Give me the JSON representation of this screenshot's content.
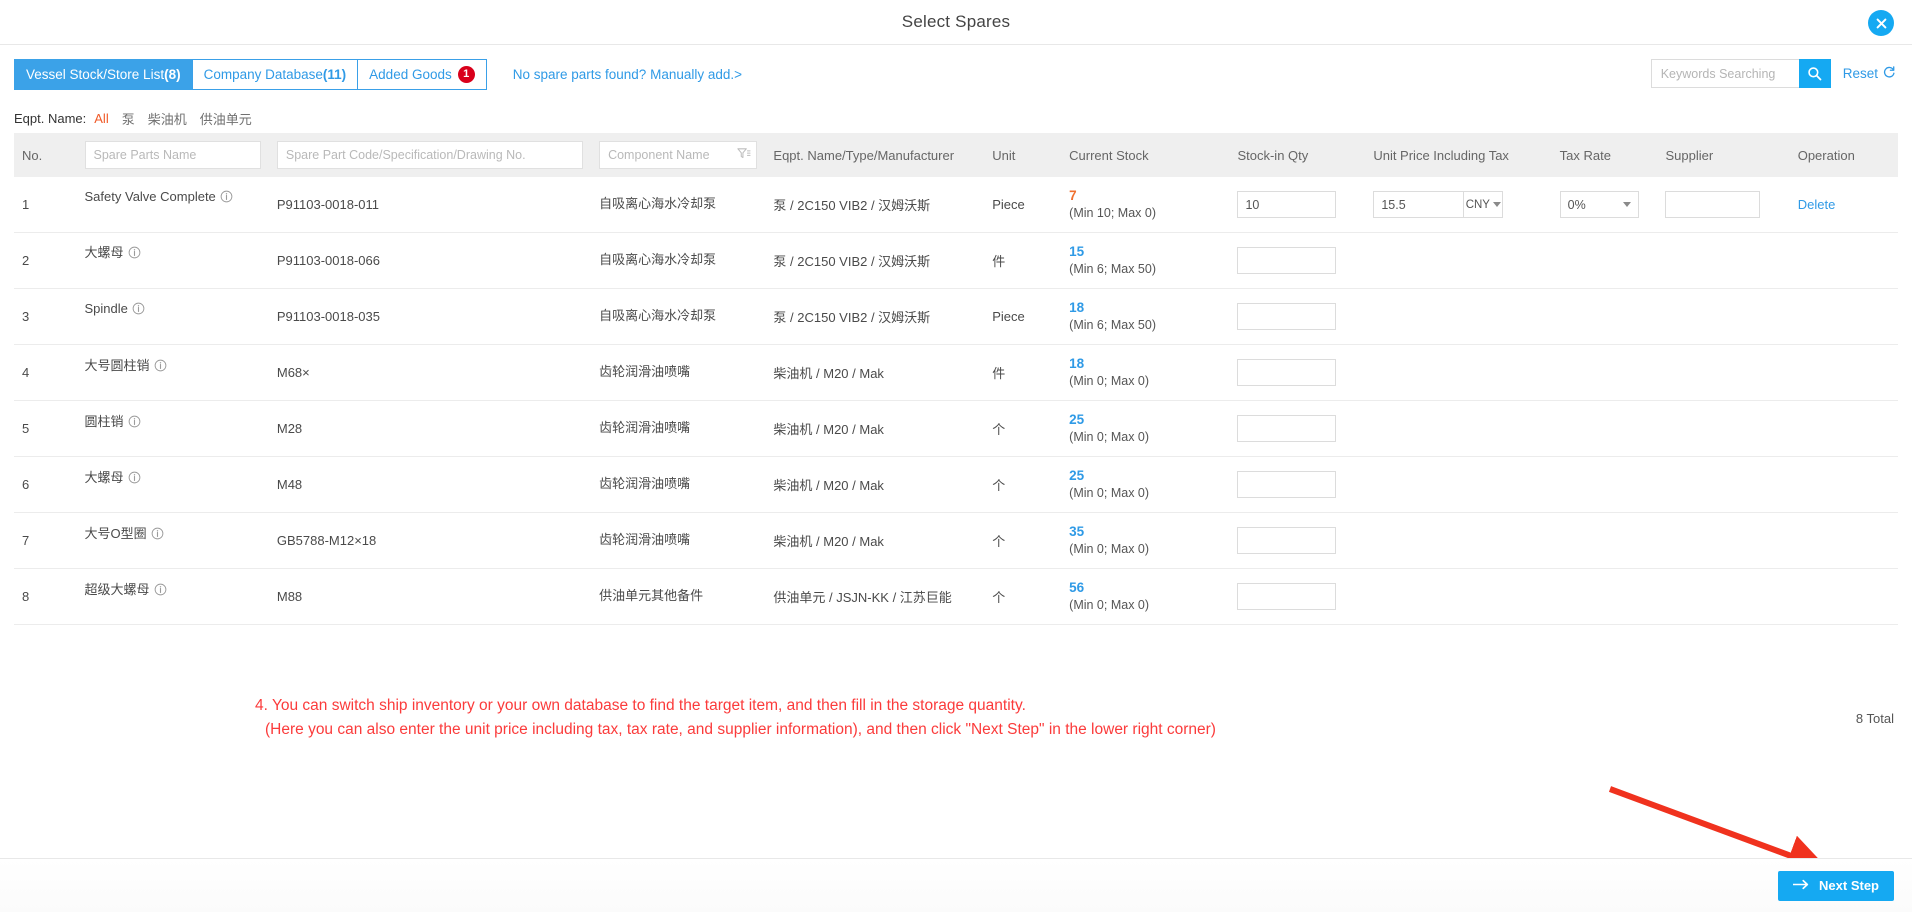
{
  "window": {
    "title": "Select Spares",
    "close_icon": "close-circle-icon"
  },
  "toolbar": {
    "tabs": [
      {
        "label": "Vessel Stock/Store List",
        "count": "(8)",
        "active": true
      },
      {
        "label": "Company Database",
        "count": "(11)",
        "active": false
      },
      {
        "label": "Added Goods",
        "badge": "1",
        "active": false
      }
    ],
    "manual_add_link": "No spare parts found? Manually add.>",
    "search": {
      "placeholder": "Keywords Searching",
      "value": "",
      "icon": "search-icon"
    },
    "reset_label": "Reset",
    "reset_icon": "refresh-icon"
  },
  "filterbar": {
    "label": "Eqpt. Name:",
    "options": [
      {
        "label": "All",
        "active": true
      },
      {
        "label": "泵",
        "active": false
      },
      {
        "label": "柴油机",
        "active": false
      },
      {
        "label": "供油单元",
        "active": false
      }
    ]
  },
  "table": {
    "headers": {
      "no": "No.",
      "spare_parts_name_placeholder": "Spare Parts Name",
      "spare_part_code_placeholder": "Spare Part Code/Specification/Drawing No.",
      "component_name_placeholder": "Component Name",
      "eqpt_name": "Eqpt. Name/Type/Manufacturer",
      "unit": "Unit",
      "current_stock": "Current Stock",
      "stock_in_qty": "Stock-in Qty",
      "unit_price": "Unit Price Including Tax",
      "tax_rate": "Tax Rate",
      "supplier": "Supplier",
      "operation": "Operation"
    },
    "rows": [
      {
        "no": "1",
        "name": "Safety Valve Complete",
        "code": "P91103-0018-011",
        "component": "自吸离心海水冷却泵",
        "eqpt": "泵 / 2C150 VIB2 / 汉姆沃斯",
        "unit": "Piece",
        "stock": "7",
        "stock_state": "low",
        "stock_range": "(Min 10; Max 0)",
        "qty": "10",
        "price": "15.5",
        "currency": "CNY",
        "tax": "0%",
        "supplier": "",
        "operation": "Delete",
        "has_price": true
      },
      {
        "no": "2",
        "name": "大螺母",
        "code": "P91103-0018-066",
        "component": "自吸离心海水冷却泵",
        "eqpt": "泵 / 2C150 VIB2 / 汉姆沃斯",
        "unit": "件",
        "stock": "15",
        "stock_state": "ok",
        "stock_range": "(Min 6; Max 50)",
        "qty": "",
        "price": "",
        "currency": "",
        "tax": "",
        "supplier": "",
        "operation": "",
        "has_price": false
      },
      {
        "no": "3",
        "name": "Spindle",
        "code": "P91103-0018-035",
        "component": "自吸离心海水冷却泵",
        "eqpt": "泵 / 2C150 VIB2 / 汉姆沃斯",
        "unit": "Piece",
        "stock": "18",
        "stock_state": "ok",
        "stock_range": "(Min 6; Max 50)",
        "qty": "",
        "price": "",
        "currency": "",
        "tax": "",
        "supplier": "",
        "operation": "",
        "has_price": false
      },
      {
        "no": "4",
        "name": "大号圆柱销",
        "code": "M68×",
        "component": "齿轮润滑油喷嘴",
        "eqpt": "柴油机 / M20 / Mak",
        "unit": "件",
        "stock": "18",
        "stock_state": "ok",
        "stock_range": "(Min 0; Max 0)",
        "qty": "",
        "price": "",
        "currency": "",
        "tax": "",
        "supplier": "",
        "operation": "",
        "has_price": false
      },
      {
        "no": "5",
        "name": "圆柱销",
        "code": "M28",
        "component": "齿轮润滑油喷嘴",
        "eqpt": "柴油机 / M20 / Mak",
        "unit": "个",
        "stock": "25",
        "stock_state": "ok",
        "stock_range": "(Min 0; Max 0)",
        "qty": "",
        "price": "",
        "currency": "",
        "tax": "",
        "supplier": "",
        "operation": "",
        "has_price": false
      },
      {
        "no": "6",
        "name": "大螺母",
        "code": "M48",
        "component": "齿轮润滑油喷嘴",
        "eqpt": "柴油机 / M20 / Mak",
        "unit": "个",
        "stock": "25",
        "stock_state": "ok",
        "stock_range": "(Min 0; Max 0)",
        "qty": "",
        "price": "",
        "currency": "",
        "tax": "",
        "supplier": "",
        "operation": "",
        "has_price": false
      },
      {
        "no": "7",
        "name": "大号O型圈",
        "code": "GB5788-M12×18",
        "component": "齿轮润滑油喷嘴",
        "eqpt": "柴油机 / M20 / Mak",
        "unit": "个",
        "stock": "35",
        "stock_state": "ok",
        "stock_range": "(Min 0; Max 0)",
        "qty": "",
        "price": "",
        "currency": "",
        "tax": "",
        "supplier": "",
        "operation": "",
        "has_price": false
      },
      {
        "no": "8",
        "name": "超级大螺母",
        "code": "M88",
        "component": "供油单元其他备件",
        "eqpt": "供油单元 / JSJN-KK / 江苏巨能",
        "unit": "个",
        "stock": "56",
        "stock_state": "ok",
        "stock_range": "(Min 0; Max 0)",
        "qty": "",
        "price": "",
        "currency": "",
        "tax": "",
        "supplier": "",
        "operation": "",
        "has_price": false
      }
    ],
    "total_label": "8 Total"
  },
  "annotation": {
    "line1": "4. You can switch ship inventory or your own database to find the target item, and then fill in the storage quantity.",
    "line2": "(Here you can also enter the unit price including tax, tax rate, and supplier information), and then click \"Next Step\" in the lower right corner)"
  },
  "footer": {
    "next_step_label": "Next Step",
    "next_step_icon": "arrow-right-icon"
  },
  "colors": {
    "accent": "#15a9f2",
    "tab_border": "#3aa0e8",
    "badge_red": "#d9001b",
    "low_stock": "#f07030",
    "ok_stock": "#2f9ae6",
    "annotation_red": "#fb3b3b",
    "arrow_red": "#f0321e"
  }
}
